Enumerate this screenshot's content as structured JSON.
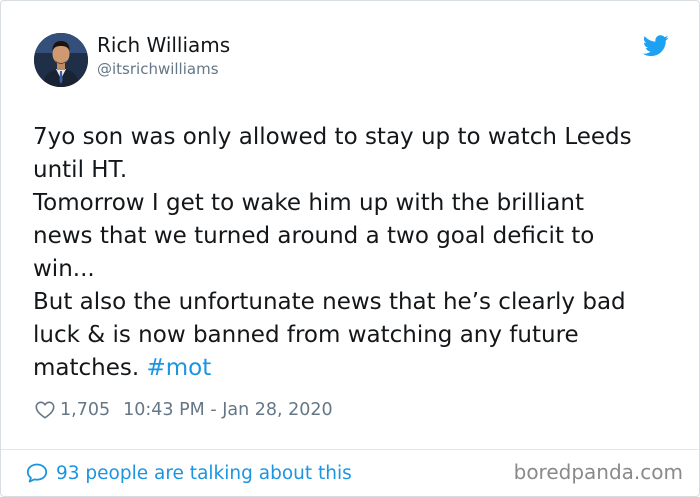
{
  "tweet": {
    "author": {
      "name": "Rich Williams",
      "handle": "@itsrichwilliams",
      "avatar_icon": "profile-photo"
    },
    "brand_icon": "twitter-bird-icon",
    "text_lines": [
      "7yo son was only allowed to stay up to watch Leeds",
      "until HT.",
      "Tomorrow I get to wake him up with the brilliant",
      "news that we turned around a two goal deficit to",
      "win...",
      "But also the unfortunate news that he’s clearly bad",
      "luck & is now banned from watching any future",
      "matches."
    ],
    "hashtag": "#mot",
    "likes": "1,705",
    "timestamp": "10:43 PM - Jan 28, 2020",
    "talking": "93 people are talking about this"
  },
  "watermark": "boredpanda.com",
  "colors": {
    "link": "#1b95e0",
    "secondary_text": "#657786",
    "primary_text": "#14171a"
  }
}
